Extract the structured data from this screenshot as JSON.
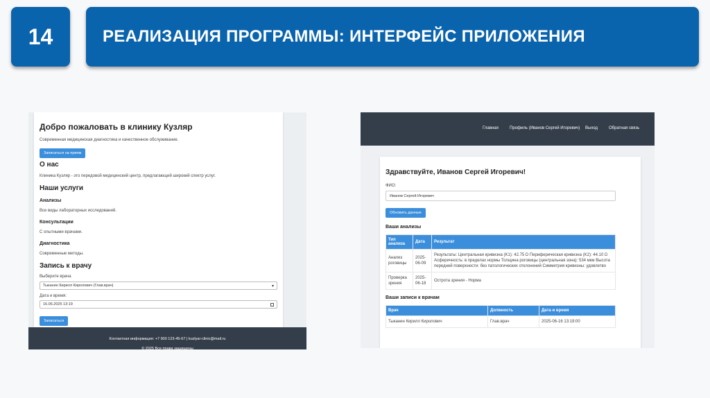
{
  "slide": {
    "number": "14",
    "title": "РЕАЛИЗАЦИЯ ПРОГРАММЫ: ИНТЕРФЕЙС ПРИЛОЖЕНИЯ"
  },
  "left_screen": {
    "welcome_title": "Добро пожаловать в клинику Кузляр",
    "welcome_text": "Современная медицинская диагностика и качественное обслуживание.",
    "signup_button": "Записаться на прием",
    "about_title": "О нас",
    "about_text": "Клиника Кузляр - это передовой медицинский центр, предлагающий широкий спектр услуг.",
    "services_title": "Наши услуги",
    "services": [
      {
        "name": "Анализы",
        "desc": "Все виды лабораторных исследований."
      },
      {
        "name": "Консультации",
        "desc": "С опытными врачами."
      },
      {
        "name": "Диагностика",
        "desc": "Современные методы."
      }
    ],
    "booking_title": "Запись к врачу",
    "doctor_label": "Выберите врача",
    "doctor_value": "Тыканин Кирилл Киролович (Глав.врач)",
    "datetime_label": "Дата и время:",
    "datetime_value": "16.06.2025 13:19",
    "submit_button": "Записаться",
    "footer_contacts": "Контактная информация: +7 900 123-45-67 | kuzlyar-clinic@mail.ru",
    "footer_copyright": "© 2025 Все права защищены"
  },
  "right_screen": {
    "nav": [
      "Главная",
      "Профиль (Иванов Сергей Игоревич)",
      "Выход",
      "Обратная связь"
    ],
    "greeting": "Здравствуйте, Иванов Сергей Игоревич!",
    "fio_label": "ФИО:",
    "fio_value": "Иванов Сергей Игоревич",
    "update_button": "Обновить данные",
    "analyses_title": "Ваши анализы",
    "analyses_headers": [
      "Тип анализа",
      "Дата",
      "Результат"
    ],
    "analyses_rows": [
      [
        "Анализ роговицы",
        "2025-06-09",
        "Результаты: Центральная кривизна (K1): 42.75 D Периферическая кривизна (K2): 44.10 D Асферичность: в пределах нормы Толщина роговицы (центральная зона): 534 мкм Высота передней поверхности: без патологических отклонений Симметрия кривизны: удовлетво"
      ],
      [
        "Проверка зрения",
        "2025-06-18",
        "Острота зрения - Норма"
      ]
    ],
    "appointments_title": "Ваши записи к врачам",
    "appointments_headers": [
      "Врач",
      "Должность",
      "Дата и время"
    ],
    "appointments_rows": [
      [
        "Тыканин Кирилл Киролович",
        "Глав.врач",
        "2025-06-16 13:19:00"
      ]
    ]
  }
}
